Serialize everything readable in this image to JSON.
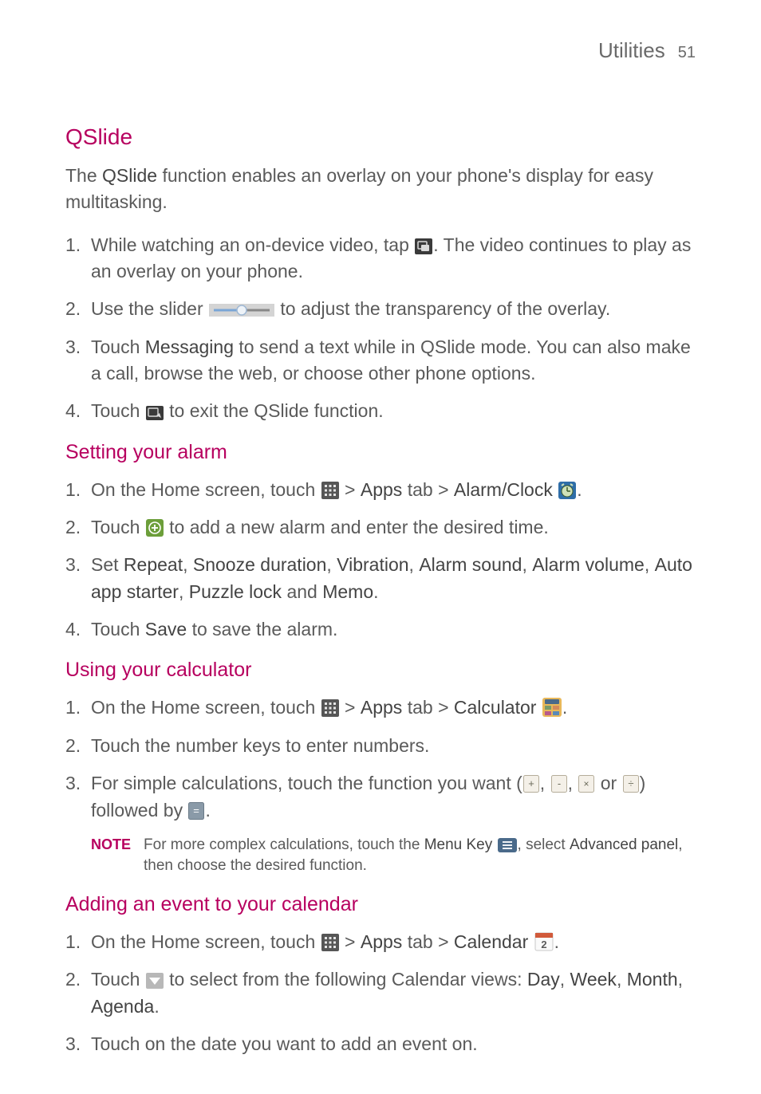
{
  "header": {
    "title": "Utilities",
    "page": "51"
  },
  "qslide": {
    "heading": "QSlide",
    "intro_pre": "The ",
    "intro_bold": "QSlide",
    "intro_post": " function enables an overlay on your phone's display for easy multitasking.",
    "s1_pre": "While watching an on-device video, tap ",
    "s1_post": ". The video continues to play as an overlay on your phone.",
    "s2_pre": "Use the slider ",
    "s2_post": " to adjust the transparency of the overlay.",
    "s3_pre": "Touch ",
    "s3_bold": "Messaging",
    "s3_post": " to send a text while in QSlide mode. You can also make a call, browse the web, or choose other phone options.",
    "s4_pre": "Touch ",
    "s4_post": " to exit the QSlide function."
  },
  "alarm": {
    "heading": "Setting your alarm",
    "s1_pre": "On the Home screen, touch ",
    "s1_mid1": " > ",
    "s1_b1": "Apps",
    "s1_mid2": " tab > ",
    "s1_b2": "Alarm/Clock",
    "s1_post": ".",
    "s2_pre": "Touch ",
    "s2_post": " to add a new alarm and enter the desired time.",
    "s3_pre": "Set ",
    "s3_b1": "Repeat",
    "c": ", ",
    "s3_b2": "Snooze duration",
    "s3_b3": "Vibration",
    "s3_b4": "Alarm sound",
    "s3_b5": "Alarm volume",
    "s3_b6": "Auto app starter",
    "s3_b7": "Puzzle lock",
    "s3_and": " and ",
    "s3_b8": "Memo",
    "s3_post": ".",
    "s4_pre": "Touch ",
    "s4_b": "Save",
    "s4_post": " to save the alarm."
  },
  "calc": {
    "heading": "Using your calculator",
    "s1_pre": "On the Home screen, touch ",
    "s1_mid1": " > ",
    "s1_b1": "Apps",
    "s1_mid2": " tab > ",
    "s1_b2": "Calculator",
    "s1_post": ".",
    "s2": "Touch the number keys to enter numbers.",
    "s3_pre": "For simple calculations, touch the function you want (",
    "sep": ", ",
    "s3_or": " or ",
    "s3_paren": ") followed by ",
    "s3_post": ".",
    "note_label": "NOTE",
    "note_pre": "For more complex calculations, touch the ",
    "note_b1": "Menu Key",
    "note_mid": ", select ",
    "note_b2": "Advanced panel",
    "note_post": ", then choose the desired function."
  },
  "cal": {
    "heading": "Adding an event to your calendar",
    "s1_pre": "On the Home screen, touch ",
    "s1_mid1": " > ",
    "s1_b1": "Apps",
    "s1_mid2": " tab > ",
    "s1_b2": "Calendar",
    "s1_post": ".",
    "s2_pre": "Touch ",
    "s2_mid": " to select from the following Calendar views: ",
    "s2_b1": "Day",
    "c": ", ",
    "s2_b2": "Week",
    "s2_b3": "Month",
    "s2_b4": "Agenda",
    "s2_post": ".",
    "s3": "Touch on the date you want to add an event on."
  },
  "glyphs": {
    "plus": "+",
    "minus": "-",
    "times": "×",
    "divide": "÷",
    "equals": "=",
    "two": "2"
  }
}
